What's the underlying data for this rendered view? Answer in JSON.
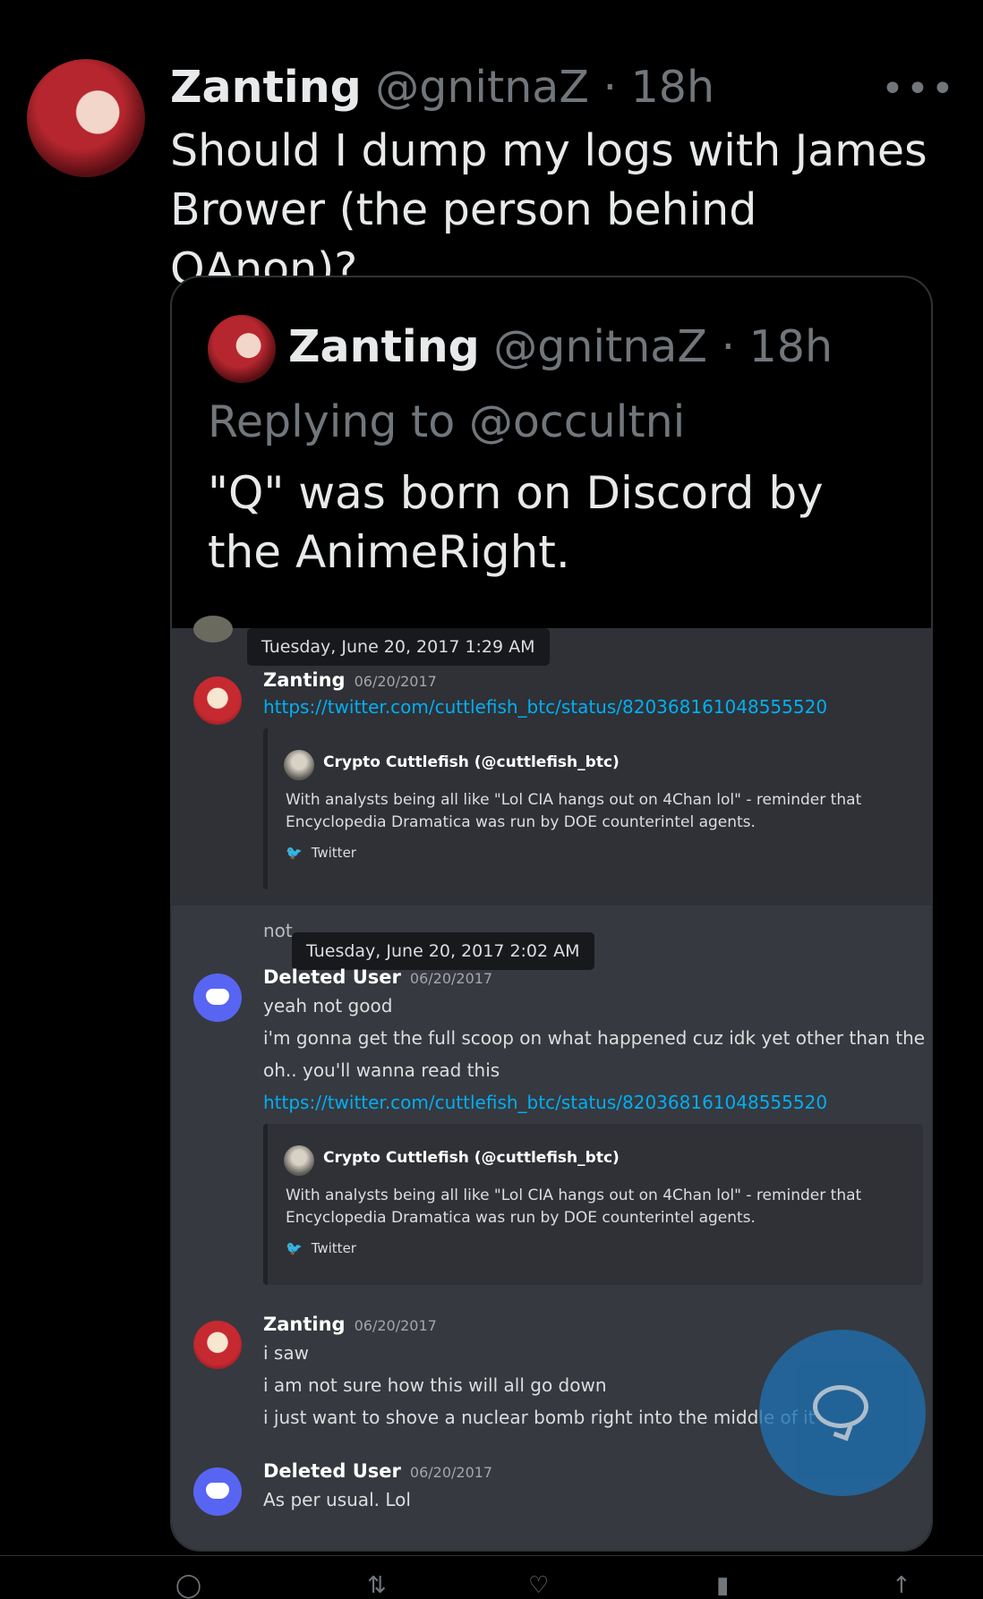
{
  "tweet": {
    "author_name": "Zanting",
    "handle_time": "@gnitnaZ · 18h",
    "more": "•••",
    "text": "Should I dump my logs with James Brower (the person behind QAnon)?"
  },
  "quoted": {
    "author_name": "Zanting",
    "handle_time": "@gnitnaZ · 18h",
    "replying_to": "Replying to @occultni",
    "text": "\"Q\" was born on Discord by the AnimeRight."
  },
  "discord": {
    "tooltip1": "Tuesday, June 20, 2017 1:29 AM",
    "tooltip2": "Tuesday, June 20, 2017 2:02 AM",
    "msg1": {
      "author": "Zanting",
      "time": "06/20/2017",
      "link": "https://twitter.com/cuttlefish_btc/status/820368161048555520"
    },
    "embed1": {
      "author": "Crypto Cuttlefish (@cuttlefish_btc)",
      "body": "With analysts being all like \"Lol CIA hangs out on 4Chan lol\" - reminder that Encyclopedia Dramatica was run by DOE counterintel agents.",
      "footer": "Twitter"
    },
    "partial_text": "not",
    "msg2": {
      "author": "Deleted User",
      "time": "06/20/2017",
      "lines": [
        "yeah not good",
        "i'm gonna get the full scoop on what happened cuz idk yet other than the tweets",
        "oh.. you'll wanna read this"
      ],
      "link": "https://twitter.com/cuttlefish_btc/status/820368161048555520"
    },
    "embed2": {
      "author": "Crypto Cuttlefish (@cuttlefish_btc)",
      "body": "With analysts being all like \"Lol CIA hangs out on 4Chan lol\" - reminder that Encyclopedia Dramatica was run by DOE counterintel agents.",
      "footer": "Twitter"
    },
    "msg3": {
      "author": "Zanting",
      "time": "06/20/2017",
      "lines": [
        "i saw",
        "i am not sure how this will all go down",
        "i just want to shove a nuclear bomb right into the middle of it"
      ]
    },
    "msg4": {
      "author": "Deleted User",
      "time": "06/20/2017",
      "lines": [
        "As per usual. Lol"
      ]
    }
  }
}
